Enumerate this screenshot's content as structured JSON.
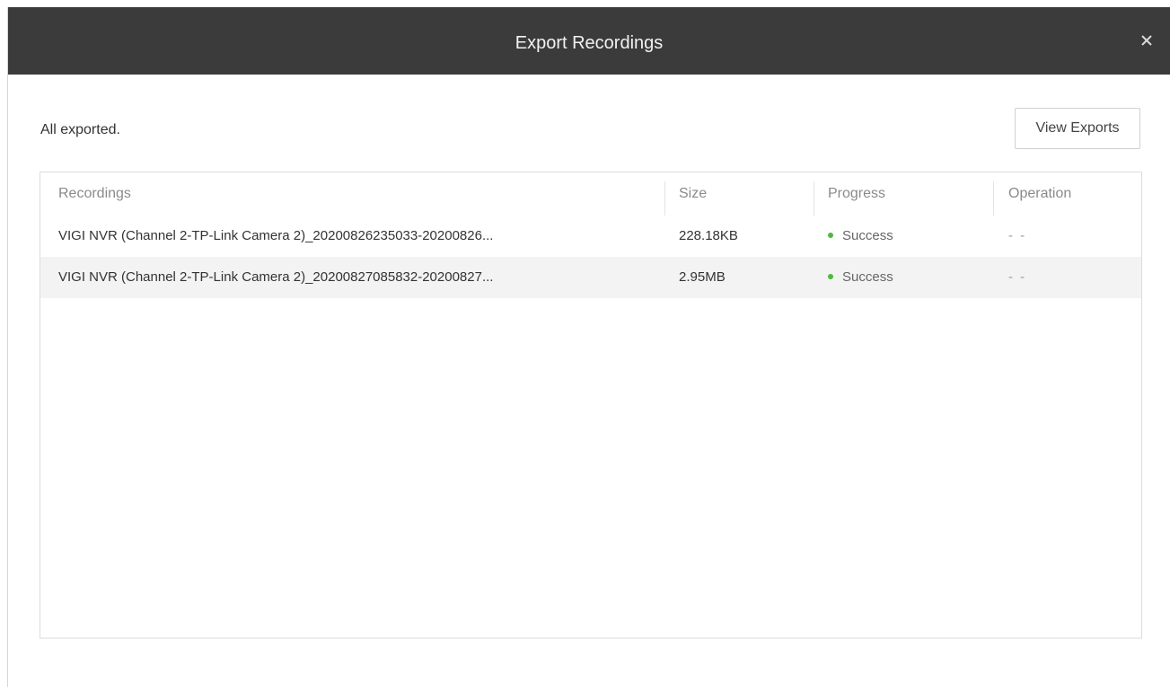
{
  "dialog": {
    "title": "Export Recordings",
    "close_icon": "close-icon"
  },
  "status": {
    "message": "All exported."
  },
  "toolbar": {
    "view_exports_label": "View Exports"
  },
  "table": {
    "headers": {
      "recordings": "Recordings",
      "size": "Size",
      "progress": "Progress",
      "operation": "Operation"
    },
    "rows": [
      {
        "recording": "VIGI NVR (Channel  2-TP-Link Camera 2)_20200826235033-20200826...",
        "size": "228.18KB",
        "progress": "Success",
        "operation": "- -"
      },
      {
        "recording": "VIGI NVR (Channel  2-TP-Link Camera 2)_20200827085832-20200827...",
        "size": "2.95MB",
        "progress": "Success",
        "operation": "- -"
      }
    ]
  },
  "colors": {
    "titlebar": "#3b3b3b",
    "success_dot": "#4cba3c",
    "alt_row": "#f3f3f3"
  }
}
